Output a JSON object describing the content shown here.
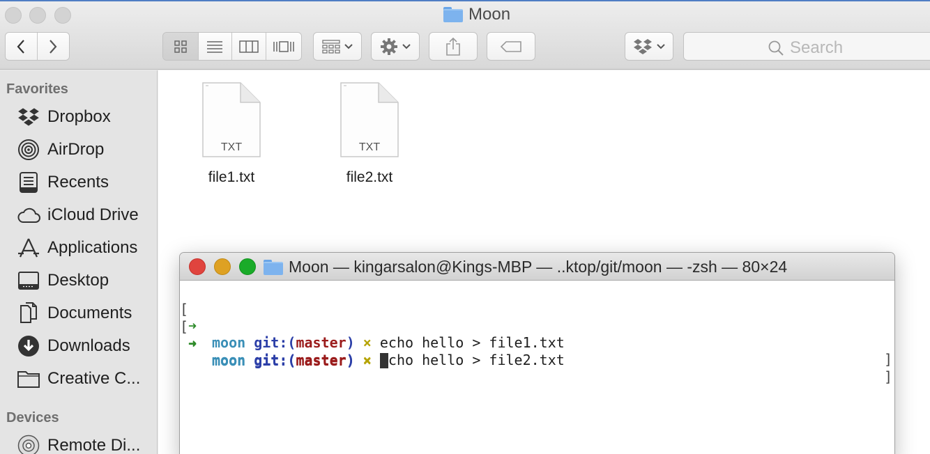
{
  "finder": {
    "title": "Moon",
    "search_placeholder": "Search",
    "icons": {
      "back": "chevron-left-icon",
      "forward": "chevron-right-icon",
      "view_icons": "icon-view-icon",
      "view_list": "list-view-icon",
      "view_columns": "column-view-icon",
      "view_gallery": "gallery-view-icon",
      "arrange": "arrange-grid-icon",
      "action": "gear-icon",
      "share": "share-icon",
      "tags": "tag-icon",
      "dropbox": "dropbox-icon",
      "search": "search-icon"
    }
  },
  "sidebar": {
    "favorites_heading": "Favorites",
    "devices_heading": "Devices",
    "favorites": [
      {
        "label": "Dropbox",
        "icon": "dropbox-icon"
      },
      {
        "label": "AirDrop",
        "icon": "airdrop-icon"
      },
      {
        "label": "Recents",
        "icon": "recents-icon"
      },
      {
        "label": "iCloud Drive",
        "icon": "cloud-icon"
      },
      {
        "label": "Applications",
        "icon": "applications-icon"
      },
      {
        "label": "Desktop",
        "icon": "desktop-icon"
      },
      {
        "label": "Documents",
        "icon": "documents-icon"
      },
      {
        "label": "Downloads",
        "icon": "downloads-icon"
      },
      {
        "label": "Creative C...",
        "icon": "folder-icon"
      }
    ],
    "devices": [
      {
        "label": "Remote Di...",
        "icon": "disc-icon"
      }
    ]
  },
  "files": [
    {
      "name": "file1.txt",
      "type_label": "TXT"
    },
    {
      "name": "file2.txt",
      "type_label": "TXT"
    }
  ],
  "terminal": {
    "title": "Moon — kingarsalon@Kings-MBP — ..ktop/git/moon — -zsh — 80×24",
    "prompt_dir": "moon",
    "prompt_git": "git:(",
    "prompt_branch": "master",
    "prompt_close": ")",
    "dirty_mark": "×",
    "arrow": "➜",
    "bracket_left": "[",
    "bracket_right": "]",
    "lines": [
      {
        "command": "echo hello > file1.txt"
      },
      {
        "command": "echo hello > file2.txt"
      },
      {
        "command": ""
      }
    ]
  },
  "colors": {
    "close": "#e0443e",
    "minimize": "#dea123",
    "zoom": "#1aab29",
    "folder_blue": "#7db3ee"
  }
}
